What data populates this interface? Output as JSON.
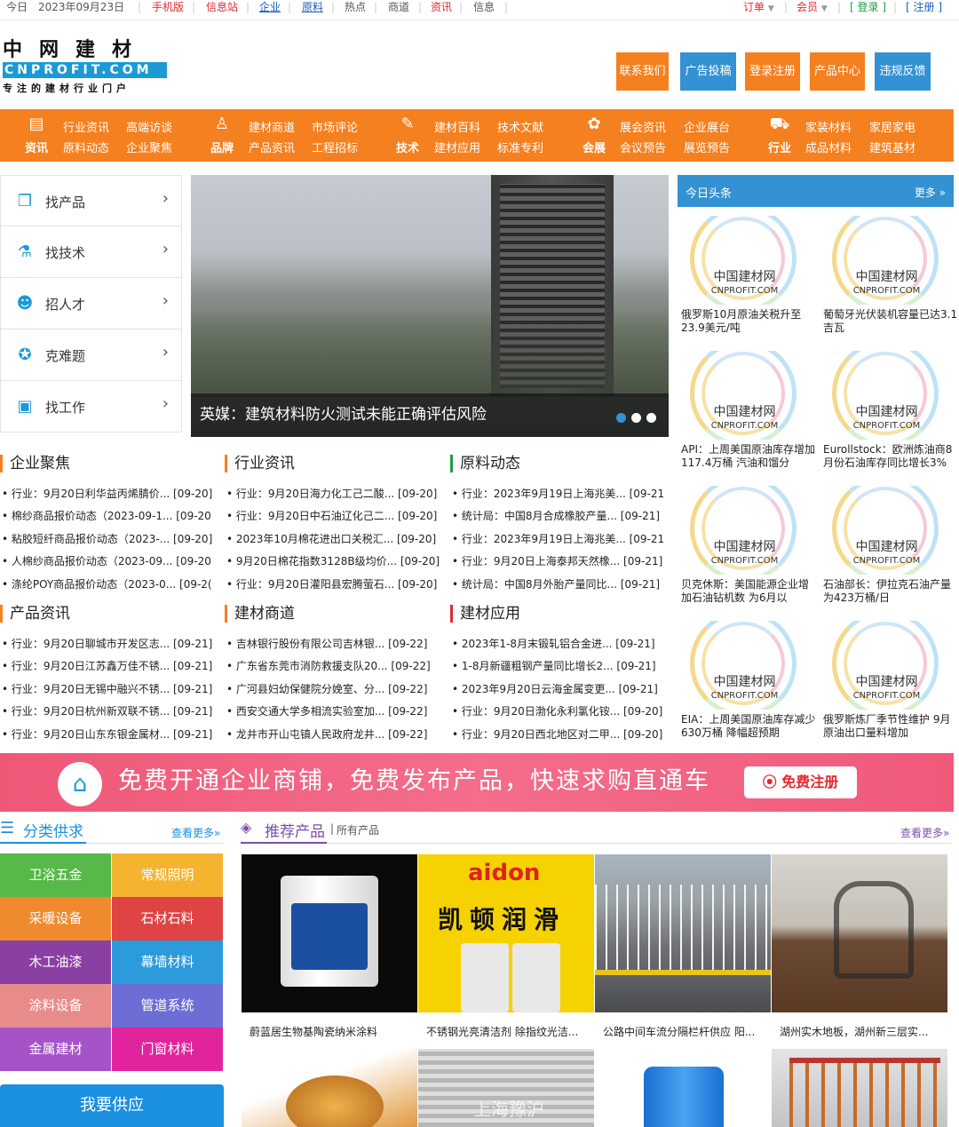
{
  "topbar": {
    "today": "今日",
    "date": "2023年09月23日",
    "mobile": "手机版",
    "info": "信息站",
    "enterprise": "企业",
    "material": "原料",
    "hot": "热点",
    "business": "商道",
    "news": "资讯",
    "message": "信息",
    "order": "订单",
    "member": "会员",
    "login": "登录",
    "register": "注册"
  },
  "logo": {
    "cn": "中网建材",
    "en": "CNPROFIT.COM",
    "slogan": "专注的建材行业门户"
  },
  "header_buttons": [
    {
      "label": "联系我们",
      "color": "#f5801f"
    },
    {
      "label": "广告投稿",
      "color": "#3491d3"
    },
    {
      "label": "登录注册",
      "color": "#f5801f"
    },
    {
      "label": "产品中心",
      "color": "#f5801f"
    },
    {
      "label": "违规反馈",
      "color": "#3491d3"
    }
  ],
  "nav": {
    "groups": [
      {
        "title": "资讯",
        "icon": "news-icon",
        "links": [
          "行业资讯",
          "高端访谈",
          "原料动态",
          "企业聚焦"
        ]
      },
      {
        "title": "品牌",
        "icon": "award-icon",
        "links": [
          "建材商道",
          "市场评论",
          "产品资讯",
          "工程招标"
        ]
      },
      {
        "title": "技术",
        "icon": "tool-icon",
        "links": [
          "建材百科",
          "技术文献",
          "建材应用",
          "标准专利"
        ]
      },
      {
        "title": "会展",
        "icon": "exhibition-icon",
        "links": [
          "展会资讯",
          "企业展台",
          "会议预告",
          "展览预告"
        ]
      },
      {
        "title": "行业",
        "icon": "cart-icon",
        "links": [
          "家装材料",
          "家居家电",
          "成品材料",
          "建筑基材"
        ]
      }
    ]
  },
  "side_menu": [
    {
      "label": "找产品",
      "icon": "box-icon"
    },
    {
      "label": "找技术",
      "icon": "flask-icon"
    },
    {
      "label": "招人才",
      "icon": "graduate-icon"
    },
    {
      "label": "克难题",
      "icon": "puzzle-icon"
    },
    {
      "label": "找工作",
      "icon": "briefcase-icon"
    }
  ],
  "slider": {
    "caption": "英媒：建筑材料防火测试未能正确评估风险"
  },
  "headlines": {
    "title": "今日头条",
    "more": "更多 »",
    "logo_cn": "中国建材网",
    "logo_en": "CNPROFIT.COM",
    "items": [
      "俄罗斯10月原油关税升至23.9美元/吨",
      "葡萄牙光伏装机容量已达3.1吉瓦",
      "API：上周美国原油库存增加117.4万桶 汽油和馏分",
      "Eurollstock：欧洲炼油商8月份石油库存同比增长3%",
      "贝克休斯：美国能源企业增加石油钻机数 为6月以",
      "石油部长：伊拉克石油产量为423万桶/日",
      "EIA：上周美国原油库存减少630万桶 降幅超预期",
      "俄罗斯炼厂季节性维护 9月原油出口量料增加"
    ]
  },
  "news_sections": [
    {
      "title": "企业聚焦",
      "items": [
        "• 行业：9月20日利华益丙烯腈价... [09-20]",
        "• 棉纱商品报价动态（2023-09-1... [09-20",
        "• 粘胶短纤商品报价动态（2023-... [09-20]",
        "• 人棉纱商品报价动态（2023-09... [09-20",
        "• 涤纶POY商品报价动态（2023-0... [09-2("
      ]
    },
    {
      "title": "行业资讯",
      "items": [
        "• 行业：9月20日海力化工己二酸... [09-20]",
        "• 行业：9月20日中石油辽化己二... [09-20]",
        "• 2023年10月棉花进出口关税汇... [09-20]",
        "• 9月20日棉花指数3128B级均价... [09-20]",
        "• 行业：9月20日灌阳县宏腾萤石... [09-20]"
      ]
    },
    {
      "title": "原料动态",
      "items": [
        "• 行业：2023年9月19日上海兆美... [09-21",
        "• 统计局：中国8月合成橡胶产量... [09-21]",
        "• 行业：2023年9月19日上海兆美... [09-21",
        "• 行业：9月20日上海泰邦天然橡... [09-21]",
        "• 统计局：中国8月外胎产量同比... [09-21]"
      ]
    },
    {
      "title": "产品资讯",
      "items": [
        "• 行业：9月20日聊城市开发区志... [09-21]",
        "• 行业：9月20日江苏鑫万佳不锈... [09-21]",
        "• 行业：9月20日无锡中融兴不锈... [09-21]",
        "• 行业：9月20日杭州新双联不锈... [09-21]",
        "• 行业：9月20日山东东银金属材... [09-21]"
      ]
    },
    {
      "title": "建材商道",
      "items": [
        "• 吉林银行股份有限公司吉林银... [09-22]",
        "• 广东省东莞市消防救援支队20... [09-22]",
        "• 广河县妇幼保健院分娩室、分... [09-22]",
        "• 西安交通大学多相流实验室加... [09-22]",
        "• 龙井市开山屯镇人民政府龙井... [09-22]"
      ]
    },
    {
      "title": "建材应用",
      "items": [
        "• 2023年1-8月末锻轧铝合金进... [09-21]",
        "• 1-8月新疆粗钢产量同比增长2... [09-21]",
        "• 2023年9月20日云海金属变更... [09-21]",
        "• 行业：9月20日渤化永利氯化铵... [09-20]",
        "• 行业：9月20日西北地区对二甲... [09-20]"
      ]
    }
  ],
  "banner": {
    "text": "免费开通企业商铺，免费发布产品，快速求购直通车",
    "button": "免费注册"
  },
  "categories": {
    "title": "分类供求",
    "more": "查看更多»",
    "items": [
      {
        "label": "卫浴五金",
        "color": "#56b948"
      },
      {
        "label": "常规照明",
        "color": "#f4b430"
      },
      {
        "label": "采暖设备",
        "color": "#ef8a2f"
      },
      {
        "label": "石材石料",
        "color": "#e04343"
      },
      {
        "label": "木工油漆",
        "color": "#8a3fa3"
      },
      {
        "label": "幕墙材料",
        "color": "#2b9bdc"
      },
      {
        "label": "涂料设备",
        "color": "#e88b8b"
      },
      {
        "label": "管道系统",
        "color": "#6d6dd6"
      },
      {
        "label": "金属建材",
        "color": "#a554c8"
      },
      {
        "label": "门窗材料",
        "color": "#e2249c"
      }
    ],
    "supply": "我要供应"
  },
  "products": {
    "title": "推荐产品",
    "sub": "所有产品",
    "more": "查看更多»",
    "items": [
      "蔚蓝居生物基陶瓷纳米涂料",
      "不锈钢光亮清洁剂 除指纹光洁...",
      "公路中间车流分隔栏杆供应 阳...",
      "湖州实木地板，湖州新三层实..."
    ],
    "img_text": {
      "brand": "aidon",
      "brand_cn": "凯顿润滑",
      "watermark": "上海豫沪"
    }
  }
}
